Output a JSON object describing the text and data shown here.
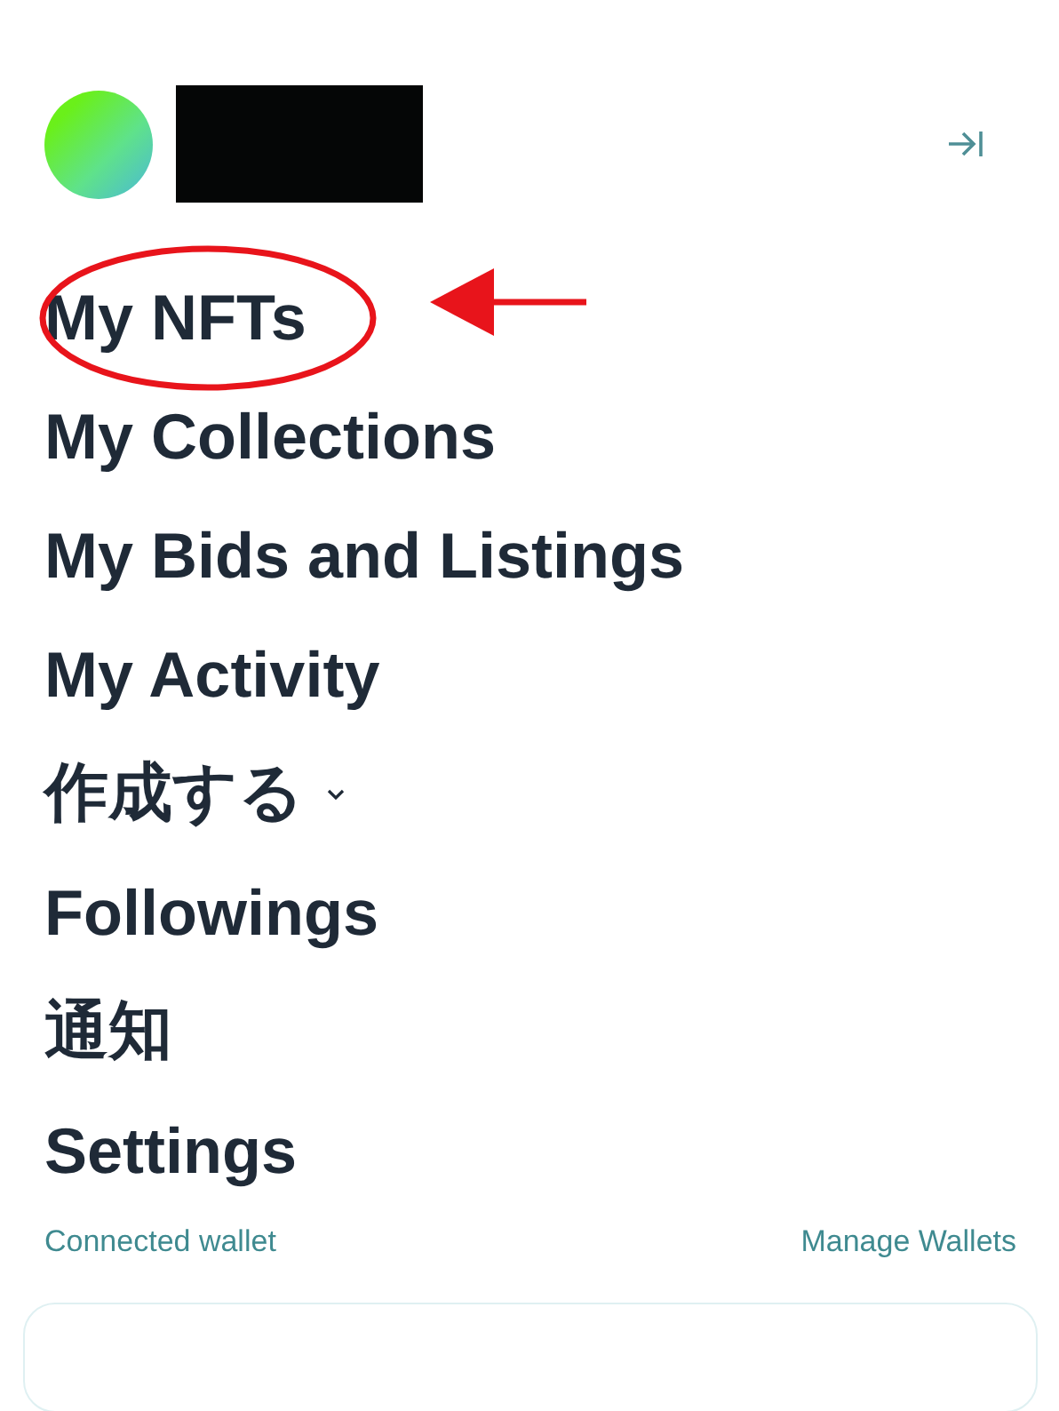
{
  "profile": {
    "redacted": true
  },
  "menu": [
    {
      "label": "My NFTs",
      "kind": "link",
      "annotated": true
    },
    {
      "label": "My Collections",
      "kind": "link",
      "annotated": false
    },
    {
      "label": "My Bids and Listings",
      "kind": "link",
      "annotated": false
    },
    {
      "label": "My Activity",
      "kind": "link",
      "annotated": false
    },
    {
      "label": "作成する",
      "kind": "dropdown",
      "annotated": false
    },
    {
      "label": "Followings",
      "kind": "link",
      "annotated": false
    },
    {
      "label": "通知",
      "kind": "link",
      "annotated": false
    },
    {
      "label": "Settings",
      "kind": "link",
      "annotated": false
    }
  ],
  "wallet": {
    "label": "Connected wallet",
    "link": "Manage Wallets"
  }
}
